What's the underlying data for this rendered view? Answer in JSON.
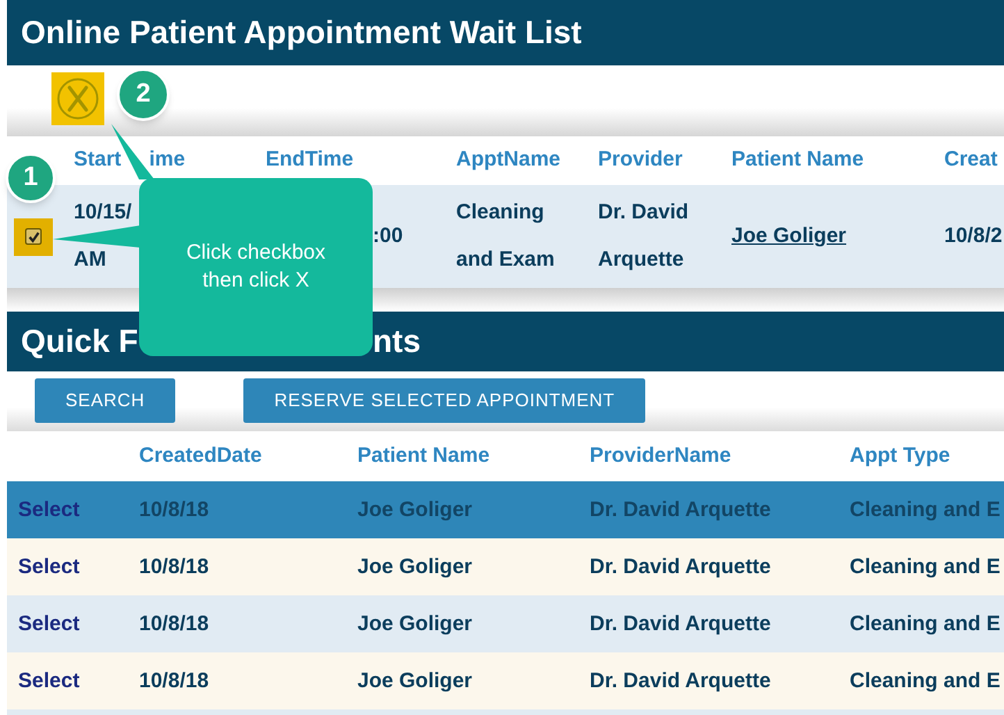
{
  "title": "Online Patient Appointment Wait List",
  "wait_list": {
    "columns": [
      {
        "parts": [
          "Start",
          "ime"
        ]
      },
      {
        "parts": [
          "EndTime"
        ]
      },
      {
        "parts": [
          "ApptName"
        ]
      },
      {
        "parts": [
          "Provider"
        ]
      },
      {
        "parts": [
          "Patient Name"
        ]
      },
      {
        "parts": [
          "Creat"
        ]
      }
    ],
    "rows": [
      {
        "checked": true,
        "cells": [
          {
            "lines": [
              "10/15/",
              "AM"
            ]
          },
          {
            "lines": [
              ":00"
            ]
          },
          {
            "lines": [
              "Cleaning",
              "and Exam"
            ]
          },
          {
            "lines": [
              "Dr. David",
              "Arquette"
            ]
          },
          {
            "kind": "link",
            "lines": [
              "Joe Goliger"
            ]
          },
          {
            "lines": [
              "10/8/2"
            ]
          }
        ]
      }
    ]
  },
  "quick_title_parts": [
    "Quick F",
    "nts"
  ],
  "buttons": [
    "SEARCH",
    "RESERVE SELECTED APPOINTMENT"
  ],
  "quick_table": {
    "columns": [
      "",
      "CreatedDate",
      "Patient Name",
      "ProviderName",
      "Appt Type"
    ],
    "rows": [
      {
        "selected": true,
        "cells": [
          "Select",
          "10/8/18",
          "Joe Goliger",
          "Dr. David Arquette",
          "Cleaning and E"
        ]
      },
      {
        "selected": false,
        "cells": [
          "Select",
          "10/8/18",
          "Joe Goliger",
          "Dr. David Arquette",
          "Cleaning and E"
        ]
      },
      {
        "selected": false,
        "cells": [
          "Select",
          "10/8/18",
          "Joe Goliger",
          "Dr. David Arquette",
          "Cleaning and E"
        ]
      },
      {
        "selected": false,
        "cells": [
          "Select",
          "10/8/18",
          "Joe Goliger",
          "Dr. David Arquette",
          "Cleaning and E"
        ]
      }
    ]
  },
  "markers": [
    "1",
    "2"
  ],
  "callout": "Click checkbox then click X"
}
